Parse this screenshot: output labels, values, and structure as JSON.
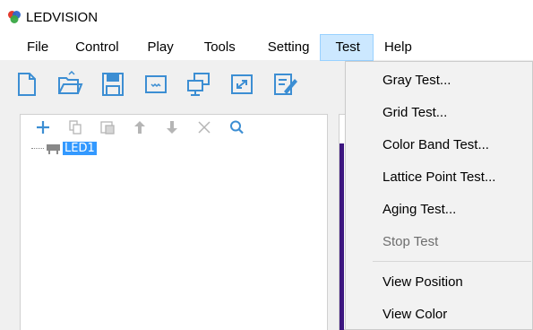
{
  "app": {
    "title": "LEDVISION"
  },
  "menubar": {
    "items": [
      {
        "label": "File",
        "active": false
      },
      {
        "label": "Control",
        "active": false
      },
      {
        "label": "Play",
        "active": false
      },
      {
        "label": "Tools",
        "active": false
      },
      {
        "label": "Setting",
        "active": false
      },
      {
        "label": "Test",
        "active": true
      },
      {
        "label": "Help",
        "active": false
      }
    ]
  },
  "toolbar": {
    "icons": [
      "new-file-icon",
      "open-folder-icon",
      "save-icon",
      "display-icon",
      "network-icon",
      "fullscreen-icon",
      "edit-icon"
    ]
  },
  "tree": {
    "tools": [
      "add-icon",
      "copy-icon",
      "paste-icon",
      "move-up-icon",
      "move-down-icon",
      "delete-icon",
      "search-icon"
    ],
    "node_label": "LED1"
  },
  "test_menu": {
    "items": [
      {
        "label": "Gray Test...",
        "disabled": false
      },
      {
        "label": "Grid Test...",
        "disabled": false
      },
      {
        "label": "Color Band Test...",
        "disabled": false
      },
      {
        "label": "Lattice Point Test...",
        "disabled": false
      },
      {
        "label": "Aging Test...",
        "disabled": false
      },
      {
        "label": "Stop Test",
        "disabled": true
      },
      {
        "label": "View Position",
        "disabled": false
      },
      {
        "label": "View Color",
        "disabled": false
      }
    ]
  },
  "colors": {
    "accent_blue": "#3c8ed3",
    "selection": "#3399ff",
    "menu_active_bg": "#cce8ff",
    "strip": "#3d1680"
  }
}
